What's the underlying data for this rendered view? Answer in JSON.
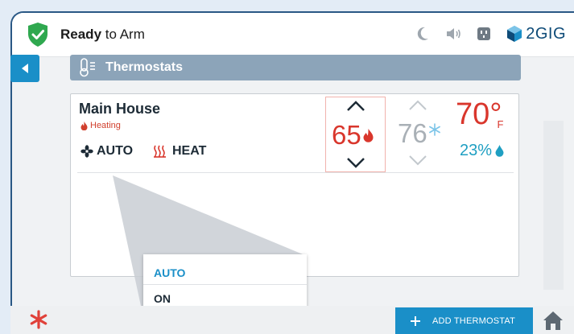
{
  "status_bar": {
    "ready_bold": "Ready",
    "ready_rest": " to Arm",
    "brand": "2GIG",
    "icons": [
      "moon-icon",
      "speaker-icon",
      "outlet-icon"
    ]
  },
  "nav": {
    "back_icon": "back-arrow-icon",
    "title": "Thermostats",
    "title_icon": "thermometer-icon"
  },
  "thermostat": {
    "name": "Main House",
    "status": "Heating",
    "fan_mode": "AUTO",
    "system_mode": "HEAT",
    "heat_setpoint": "65",
    "cool_setpoint": "76",
    "current_temp": "70°",
    "temp_unit": "F",
    "humidity": "23%"
  },
  "fan_dropdown": {
    "options": [
      "AUTO",
      "ON"
    ],
    "selected": "AUTO"
  },
  "footer": {
    "add_label": "ADD THERMOSTAT"
  },
  "colors": {
    "accent": "#1a8fc8",
    "heat": "#d9362c",
    "cool": "#a9b0b6",
    "humidity": "#1f9fc2",
    "armed_green": "#2fa84f"
  }
}
